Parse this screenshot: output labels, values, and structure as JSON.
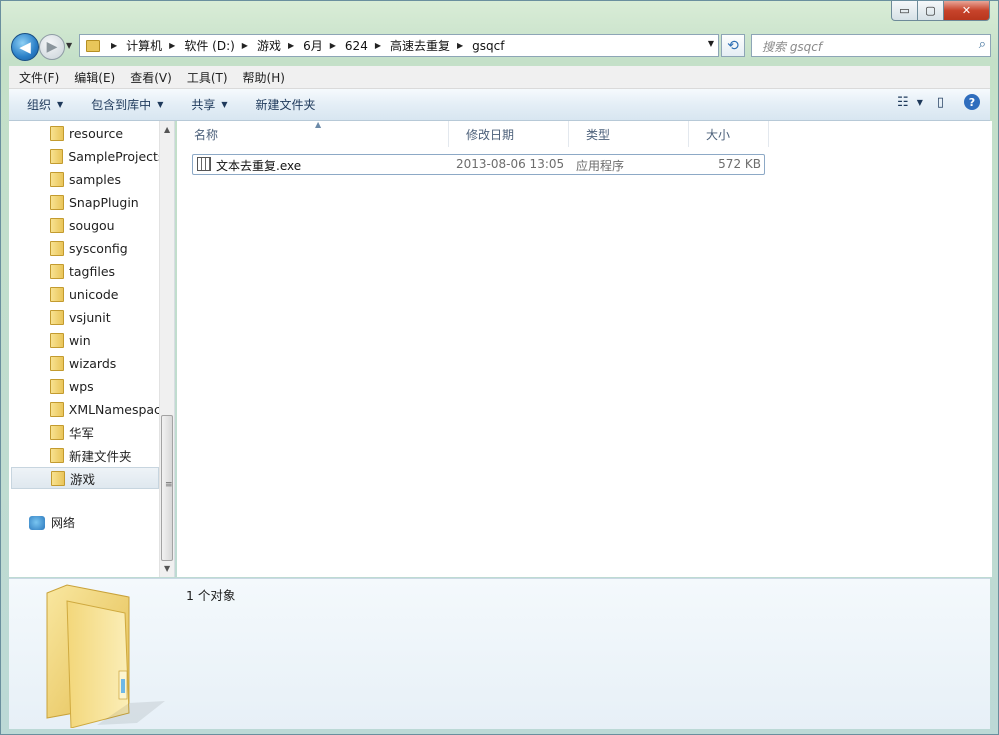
{
  "window": {
    "caption": {
      "minimize": "▭",
      "maximize": "▢",
      "close": "✕"
    }
  },
  "nav": {
    "back_glyph": "◀",
    "forward_glyph": "▶",
    "recent_glyph": "▼",
    "breadcrumb": [
      "计算机",
      "软件 (D:)",
      "游戏",
      "6月",
      "624",
      "高速去重复",
      "gsqcf"
    ],
    "breadcrumb_sep": "▶",
    "refresh_glyph": "⟲",
    "search_placeholder": "搜索 gsqcf",
    "search_icon": "search-icon"
  },
  "menubar": [
    "文件(F)",
    "编辑(E)",
    "查看(V)",
    "工具(T)",
    "帮助(H)"
  ],
  "commandbar": {
    "items": [
      {
        "label": "组织",
        "dropdown": true
      },
      {
        "label": "包含到库中",
        "dropdown": true
      },
      {
        "label": "共享",
        "dropdown": true
      },
      {
        "label": "新建文件夹",
        "dropdown": false
      }
    ],
    "view_glyph": "☷",
    "pane_glyph": "▯",
    "help_glyph": "?"
  },
  "navpane": {
    "items": [
      "resource",
      "SampleProjects",
      "samples",
      "SnapPlugin",
      "sougou",
      "sysconfig",
      "tagfiles",
      "unicode",
      "vsjunit",
      "win",
      "wizards",
      "wps",
      "XMLNamespac",
      "华军",
      "新建文件夹",
      "游戏"
    ],
    "selected_index": 15,
    "network_label": "网络"
  },
  "filelist": {
    "columns": [
      "名称",
      "修改日期",
      "类型",
      "大小"
    ],
    "sorted_column": "名称",
    "rows": [
      {
        "name": "文本去重复.exe",
        "modified": "2013-08-06 13:05",
        "type": "应用程序",
        "size": "572 KB"
      }
    ]
  },
  "details": {
    "summary": "1 个对象"
  },
  "colors": {
    "accent": "#2f6dbd",
    "close": "#c7432b",
    "folder": "#e9c55a"
  }
}
